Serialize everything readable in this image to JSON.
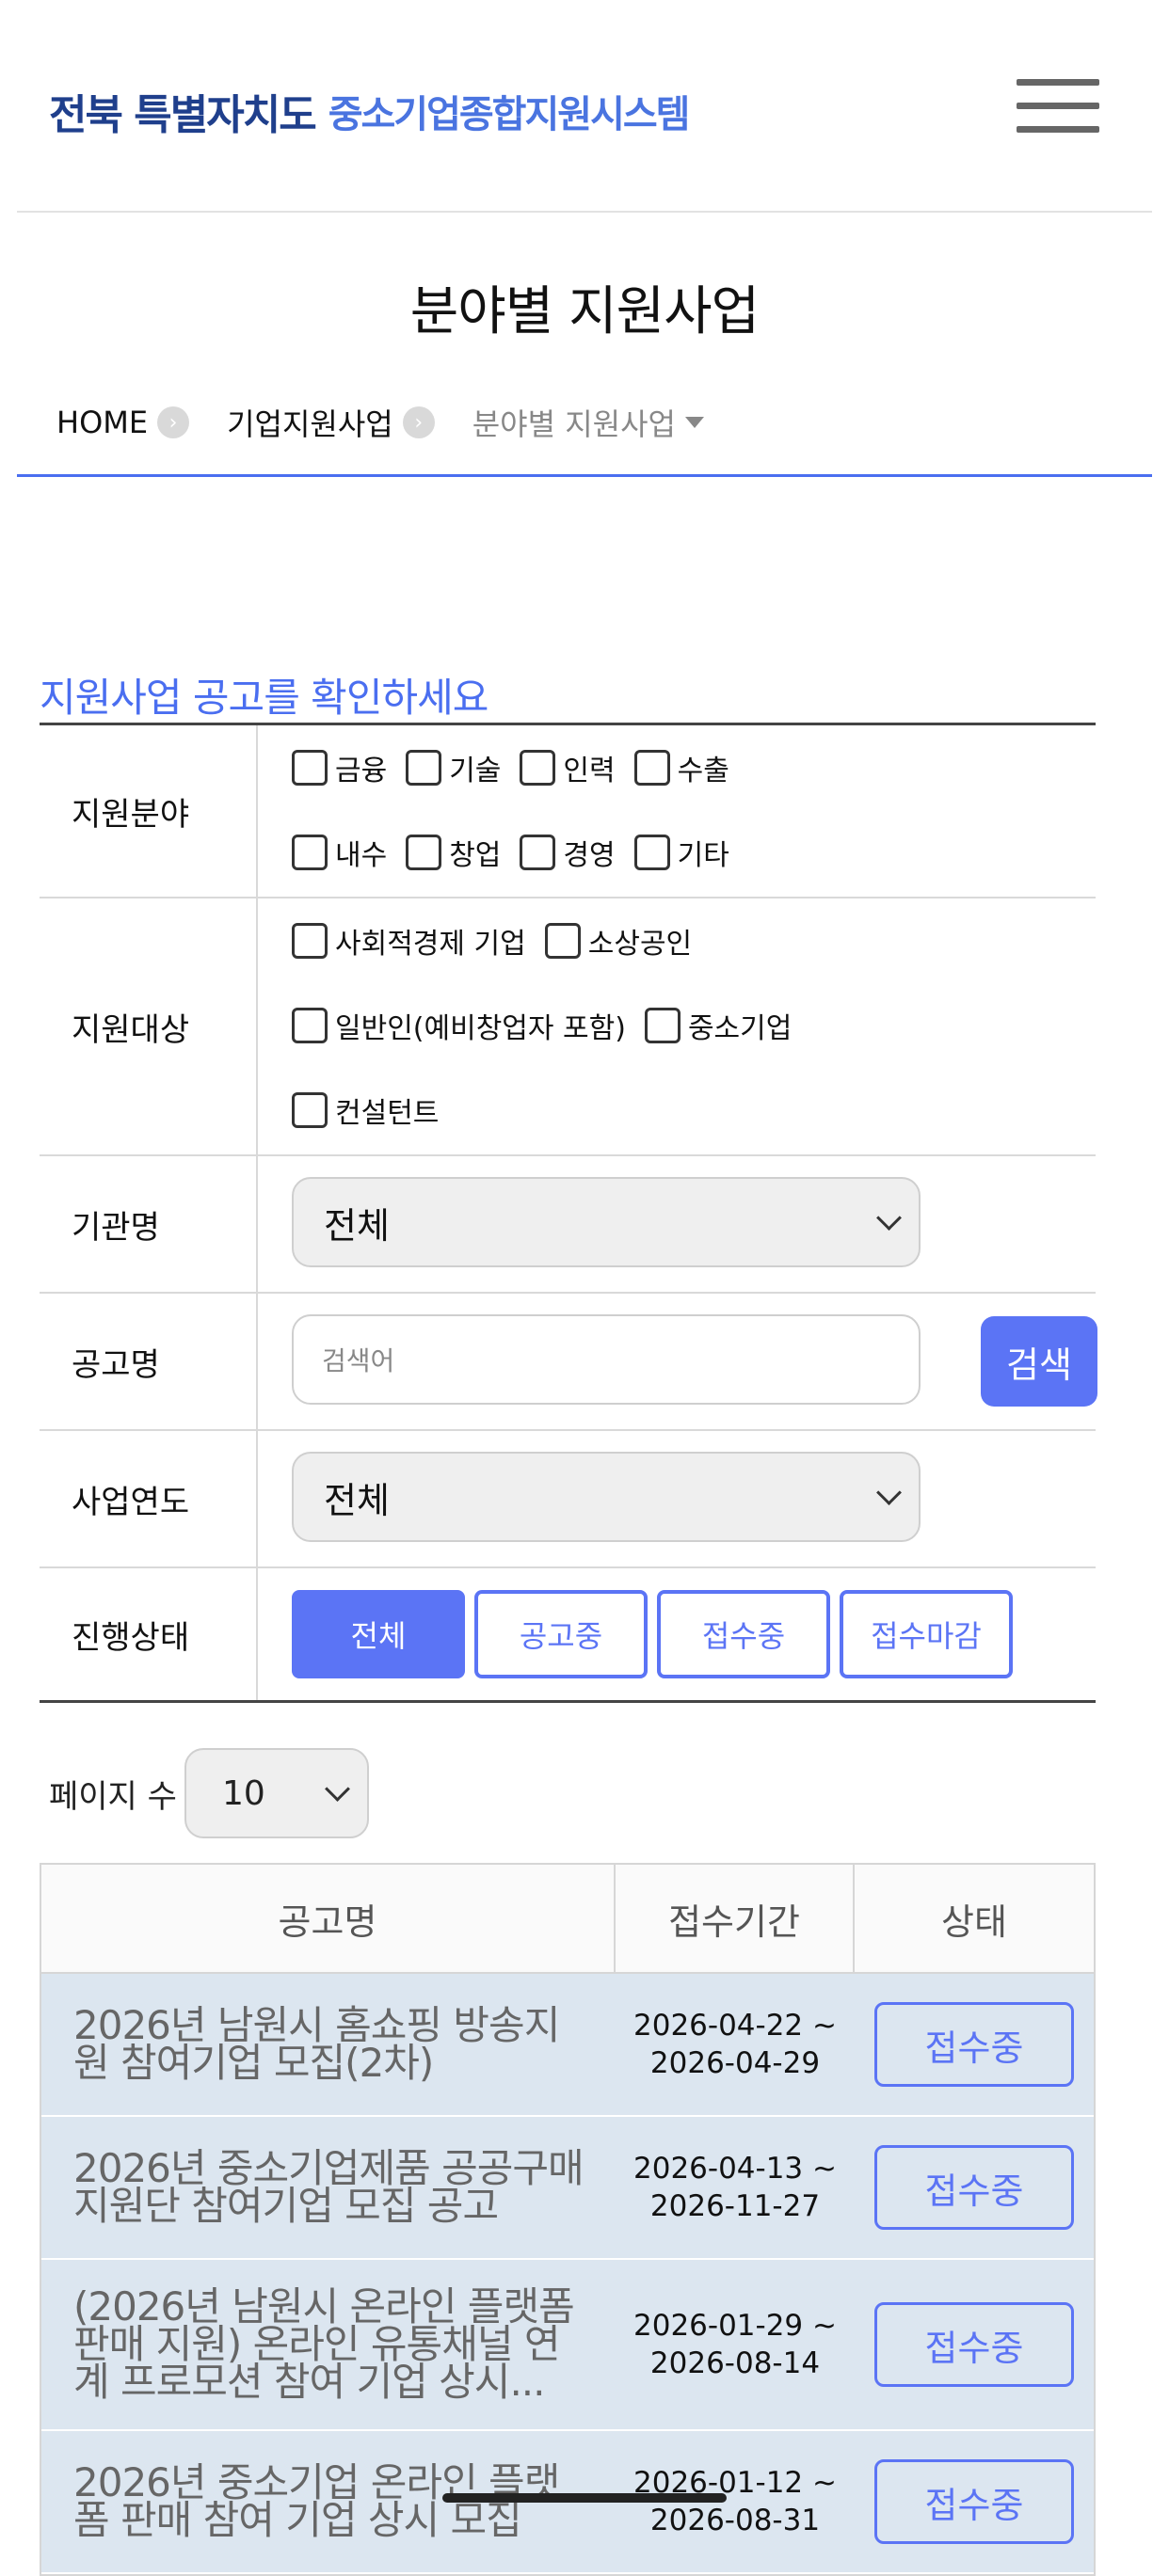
{
  "header": {
    "logo_primary": "전북 특별자치도",
    "logo_secondary": "중소기업종합지원시스템",
    "menu_icon": "hamburger-menu-icon"
  },
  "page": {
    "title": "분야별 지원사업"
  },
  "breadcrumb": {
    "items": [
      "HOME",
      "기업지원사업",
      "분야별 지원사업"
    ],
    "separator_icon": "chevron-right-icon",
    "dropdown_icon": "caret-down-icon"
  },
  "section": {
    "title": "지원사업 공고를 확인하세요"
  },
  "filters": {
    "field": {
      "label": "지원분야",
      "options": [
        "금융",
        "기술",
        "인력",
        "수출",
        "내수",
        "창업",
        "경영",
        "기타"
      ]
    },
    "target": {
      "label": "지원대상",
      "options": [
        "사회적경제 기업",
        "소상공인",
        "일반인(예비창업자 포함)",
        "중소기업",
        "컨설턴트"
      ]
    },
    "agency": {
      "label": "기관명",
      "selected": "전체"
    },
    "notice": {
      "label": "공고명",
      "placeholder": "검색어",
      "button": "검색"
    },
    "year": {
      "label": "사업연도",
      "selected": "전체"
    },
    "status": {
      "label": "진행상태",
      "options": [
        "전체",
        "공고중",
        "접수중",
        "접수마감"
      ],
      "active": "전체"
    }
  },
  "pagination": {
    "label": "페이지 수",
    "selected": "10"
  },
  "results": {
    "headers": [
      "공고명",
      "접수기간",
      "상태"
    ],
    "rows": [
      {
        "title": "2026년 남원시 홈쇼핑 방송지원 참여기업 모집(2차)",
        "start": "2026-04-22 ~",
        "end": "2026-04-29",
        "status": "접수중"
      },
      {
        "title": "2026년 중소기업제품 공공구매 지원단 참여기업 모집 공고",
        "start": "2026-04-13 ~",
        "end": "2026-11-27",
        "status": "접수중"
      },
      {
        "title": "(2026년 남원시 온라인 플랫폼 판매 지원) 온라인 유통채널 연계 프로모션 참여 기업 상시...",
        "start": "2026-01-29 ~",
        "end": "2026-08-14",
        "status": "접수중"
      },
      {
        "title": "2026년 중소기업 온라인 플랫폼 판매 참여 기업 상시 모집",
        "start": "2026-01-12 ~",
        "end": "2026-08-31",
        "status": "접수중"
      }
    ]
  },
  "colors": {
    "accent": "#5b74f5",
    "logo_dark": "#1f3f8c",
    "logo_light": "#4a74e0",
    "row_bg": "#dce6f0"
  }
}
